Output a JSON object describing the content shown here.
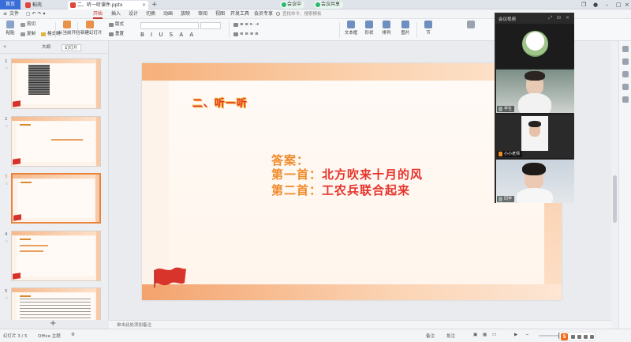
{
  "tabbar": {
    "home_label": "首页",
    "tabs": [
      {
        "label": "稻壳",
        "color": "#e0463b"
      },
      {
        "label": "二、听一听课件.pptx",
        "color": "#e0463b",
        "active": true
      }
    ],
    "meeting_pills": [
      {
        "label": "会议中",
        "color": "#2bb673"
      },
      {
        "label": "会议共享",
        "color": "#2bb673"
      }
    ]
  },
  "menubar": {
    "file_label": "文件",
    "items": [
      "开始",
      "插入",
      "设计",
      "切换",
      "动画",
      "放映",
      "审阅",
      "视图",
      "开发工具",
      "会员专享"
    ],
    "active_item": "开始",
    "search_placeholder": "查找命令、搜索模板"
  },
  "ribbon": {
    "big_buttons": [
      "粘贴",
      "新建幻灯片",
      "版式",
      "排列",
      "文本框",
      "形状",
      "图片"
    ],
    "small_buttons": [
      "剪切",
      "复制",
      "格式刷",
      "重置",
      "节",
      "从当前开始"
    ],
    "format_glyphs": "B I U S A A"
  },
  "slide_panel": {
    "tabs": [
      "大纲",
      "幻灯片"
    ],
    "active_tab": "幻灯片",
    "slides": [
      {
        "number": "1"
      },
      {
        "number": "2"
      },
      {
        "number": "3"
      },
      {
        "number": "4"
      },
      {
        "number": "5"
      }
    ],
    "selected_slide": "3"
  },
  "slide": {
    "heading": "二、听一听",
    "answer_label": "答案：",
    "line1_prefix": "第一首：",
    "line1_song": "北方吹来十月的风",
    "line2_prefix": "第二首：",
    "line2_song": "工农兵联合起来"
  },
  "notes": {
    "placeholder": "单击此处添加备注"
  },
  "statusbar": {
    "slide_count": "幻灯片 3 / 5",
    "theme": "Office 主题",
    "notes_toggle": "备注",
    "comments_toggle": "批注"
  },
  "meeting": {
    "title": "会议视频",
    "participants": [
      {
        "name": "",
        "type": "avatar"
      },
      {
        "name": "学生",
        "type": "video"
      },
      {
        "name": "小小老师",
        "type": "video",
        "host": true
      },
      {
        "name": "同学",
        "type": "video"
      }
    ]
  },
  "colors": {
    "accent": "#c0392b",
    "slide_orange": "#f08a2a",
    "slide_red": "#e6332a"
  }
}
